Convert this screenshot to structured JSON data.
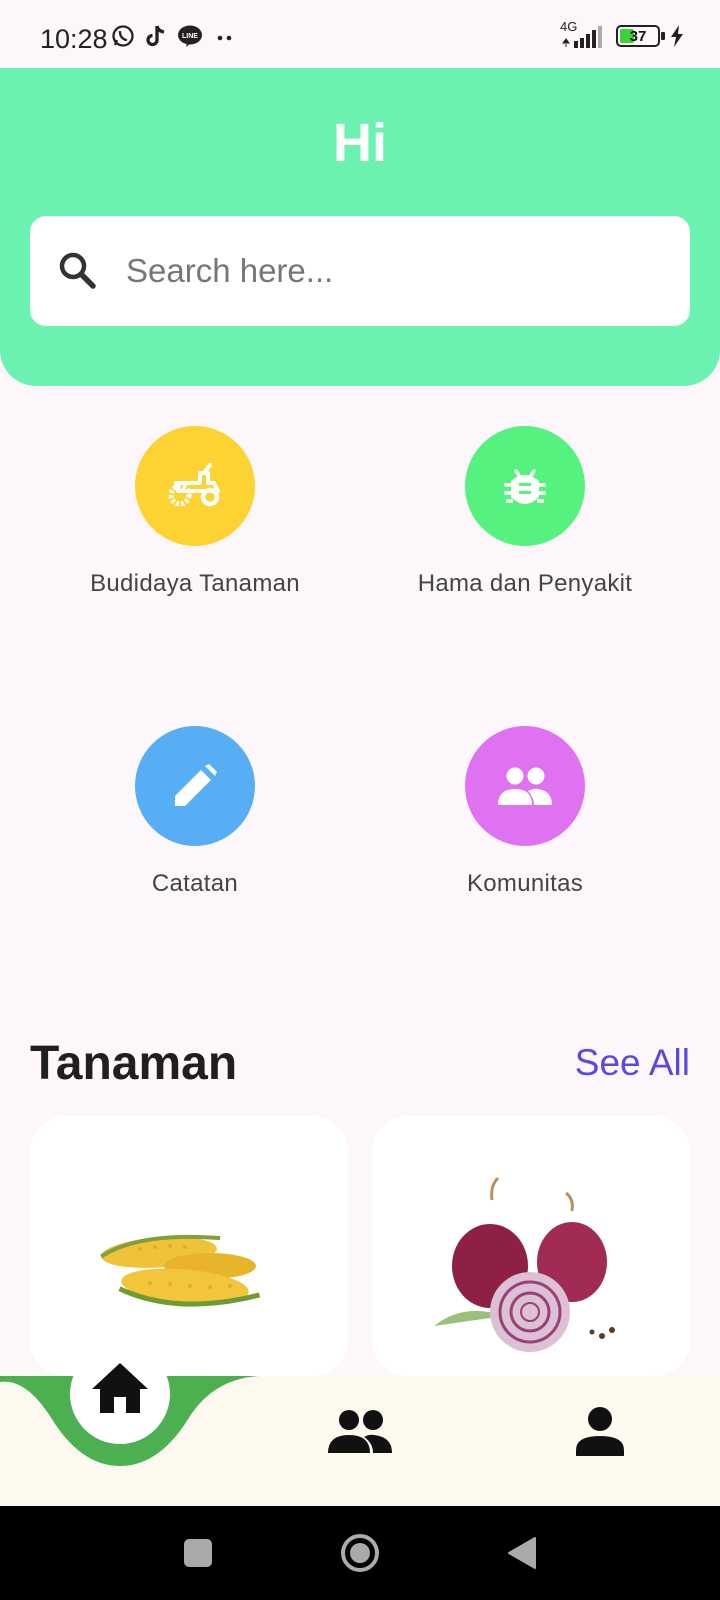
{
  "status_bar": {
    "time": "10:28",
    "network": "4G",
    "battery": "37",
    "app_icons": [
      "whatsapp-icon",
      "tiktok-icon",
      "line-icon",
      "more-dots-icon"
    ]
  },
  "header": {
    "greeting": "Hi",
    "search_placeholder": "Search here..."
  },
  "menu": [
    {
      "label": "Budidaya Tanaman",
      "icon": "tractor-icon",
      "color": "#fdd333"
    },
    {
      "label": "Hama dan Penyakit",
      "icon": "bug-icon",
      "color": "#56f27f"
    },
    {
      "label": "Catatan",
      "icon": "pencil-icon",
      "color": "#57aef5"
    },
    {
      "label": "Komunitas",
      "icon": "group-icon",
      "color": "#df72f0"
    }
  ],
  "section": {
    "title": "Tanaman",
    "see_all": "See All"
  },
  "plants": [
    {
      "image": "corn-image"
    },
    {
      "image": "red-onion-image"
    }
  ],
  "bottom_nav": {
    "items": [
      "home-icon",
      "community-icon",
      "profile-icon"
    ],
    "active": "home",
    "accent": "#4caf50"
  },
  "colors": {
    "header_bg": "#6cf2b0",
    "accent": "#5b4ae0",
    "background": "#fdf7fc"
  }
}
